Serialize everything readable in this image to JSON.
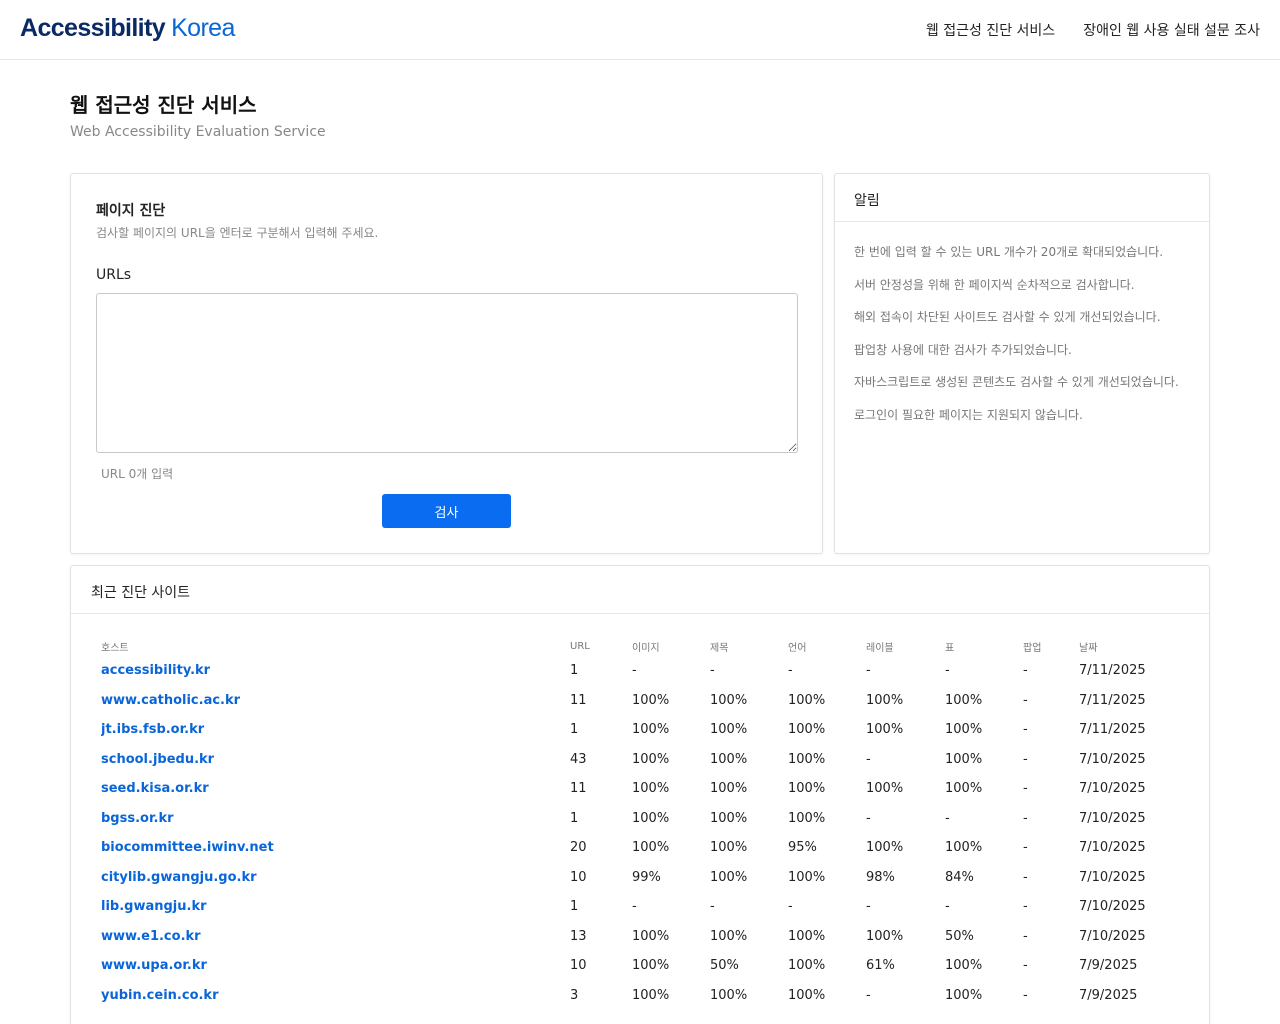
{
  "header": {
    "logo_bold": "Accessibility",
    "logo_light": "Korea",
    "nav": [
      "웹 접근성 진단 서비스",
      "장애인 웹 사용 실태 설문 조사"
    ]
  },
  "page": {
    "title": "웹 접근성 진단 서비스",
    "subtitle": "Web Accessibility Evaluation Service"
  },
  "diagnosis": {
    "title": "페이지 진단",
    "description": "검사할 페이지의 URL을 엔터로 구분해서 입력해 주세요.",
    "urls_label": "URLs",
    "urls_value": "",
    "url_count": "URL 0개 입력",
    "check_button": "검사"
  },
  "notice": {
    "title": "알림",
    "items": [
      "한 번에 입력 할 수 있는 URL 개수가 20개로 확대되었습니다.",
      "서버 안정성을 위해 한 페이지씩 순차적으로 검사합니다.",
      "해외 접속이 차단된 사이트도 검사할 수 있게 개선되었습니다.",
      "팝업창 사용에 대한 검사가 추가되었습니다.",
      "자바스크립트로 생성된 콘텐츠도 검사할 수 있게 개선되었습니다.",
      "로그인이 필요한 페이지는 지원되지 않습니다."
    ]
  },
  "recent": {
    "title": "최근 진단 사이트",
    "columns": [
      "호스트",
      "URL",
      "이미지",
      "제목",
      "언어",
      "레이블",
      "표",
      "팝업",
      "날짜"
    ],
    "rows": [
      [
        "accessibility.kr",
        "1",
        "-",
        "-",
        "-",
        "-",
        "-",
        "-",
        "7/11/2025"
      ],
      [
        "www.catholic.ac.kr",
        "11",
        "100%",
        "100%",
        "100%",
        "100%",
        "100%",
        "-",
        "7/11/2025"
      ],
      [
        "jt.ibs.fsb.or.kr",
        "1",
        "100%",
        "100%",
        "100%",
        "100%",
        "100%",
        "-",
        "7/11/2025"
      ],
      [
        "school.jbedu.kr",
        "43",
        "100%",
        "100%",
        "100%",
        "-",
        "100%",
        "-",
        "7/10/2025"
      ],
      [
        "seed.kisa.or.kr",
        "11",
        "100%",
        "100%",
        "100%",
        "100%",
        "100%",
        "-",
        "7/10/2025"
      ],
      [
        "bgss.or.kr",
        "1",
        "100%",
        "100%",
        "100%",
        "-",
        "-",
        "-",
        "7/10/2025"
      ],
      [
        "biocommittee.iwinv.net",
        "20",
        "100%",
        "100%",
        "95%",
        "100%",
        "100%",
        "-",
        "7/10/2025"
      ],
      [
        "citylib.gwangju.go.kr",
        "10",
        "99%",
        "100%",
        "100%",
        "98%",
        "84%",
        "-",
        "7/10/2025"
      ],
      [
        "lib.gwangju.kr",
        "1",
        "-",
        "-",
        "-",
        "-",
        "-",
        "-",
        "7/10/2025"
      ],
      [
        "www.e1.co.kr",
        "13",
        "100%",
        "100%",
        "100%",
        "100%",
        "50%",
        "-",
        "7/10/2025"
      ],
      [
        "www.upa.or.kr",
        "10",
        "100%",
        "50%",
        "100%",
        "61%",
        "100%",
        "-",
        "7/9/2025"
      ],
      [
        "yubin.cein.co.kr",
        "3",
        "100%",
        "100%",
        "100%",
        "-",
        "100%",
        "-",
        "7/9/2025"
      ]
    ]
  }
}
